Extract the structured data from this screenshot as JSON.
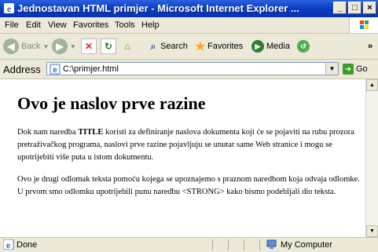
{
  "window": {
    "title": "Jednostavan HTML primjer - Microsoft Internet Explorer ..."
  },
  "menu": {
    "items": [
      "File",
      "Edit",
      "View",
      "Favorites",
      "Tools",
      "Help"
    ]
  },
  "toolbar": {
    "back": "Back",
    "search": "Search",
    "favorites": "Favorites",
    "media": "Media",
    "overflow": "»"
  },
  "address": {
    "label": "Address",
    "value": "C:\\primjer.html",
    "go": "Go"
  },
  "page": {
    "heading": "Ovo je naslov prve razine",
    "p1_before": "Dok nam naredba ",
    "p1_bold": "TITLE",
    "p1_after": " koristi za definiranje naslova dokumenta koji će se pojaviti na rubu prozora pretraživačkog programa, naslovi prve razine pojavljuju se unutar same Web stranice i mogu se upotrijebiti više puta u istom dokumentu.",
    "p2": "Ovo je drugi odlomak teksta pomoću kojega se upoznajemo s praznom naredbom koja odvaja odlomke. U prvom smo odlomku upotrijebili punu naredbu <STRONG> kako bismo podebljali dio teksta."
  },
  "status": {
    "left": "Done",
    "zone": "My Computer"
  },
  "icons": [
    "ie-icon",
    "back-icon",
    "forward-icon",
    "stop-icon",
    "refresh-icon",
    "home-icon",
    "search-icon",
    "favorites-icon",
    "media-icon",
    "history-icon",
    "go-icon",
    "computer-icon",
    "windows-logo-icon"
  ],
  "colors": {
    "titlebar": "#0a3fc5",
    "chrome": "#ece9d8",
    "content": "#ffffff"
  }
}
